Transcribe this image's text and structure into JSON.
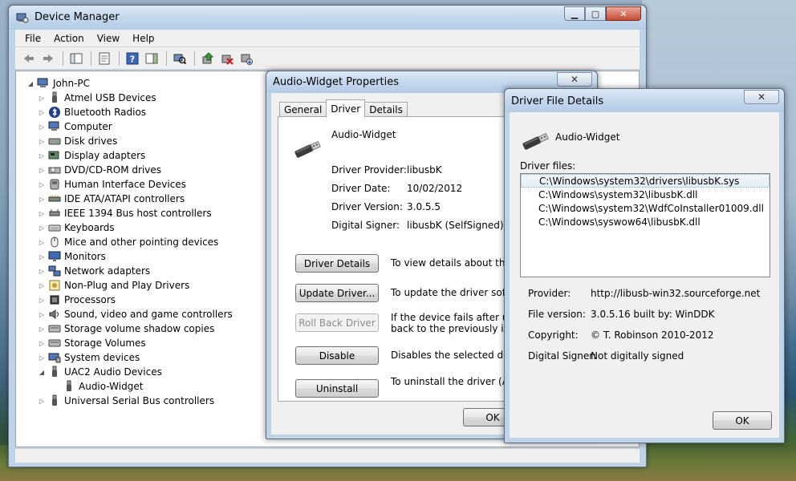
{
  "colors": {
    "selection": "#e3ecf5",
    "window_frame": "#bfd3e7",
    "close_red": "#c74a32"
  },
  "device_manager": {
    "title": "Device Manager",
    "menu": [
      "File",
      "Action",
      "View",
      "Help"
    ],
    "toolbar_icons": [
      "back-arrow-icon",
      "forward-arrow-icon",
      "console-tree-icon",
      "properties-icon",
      "help-icon",
      "action-pane-icon",
      "scan-hardware-icon",
      "update-driver-icon",
      "uninstall-icon",
      "disable-device-icon"
    ],
    "tree": {
      "root": "John-PC",
      "categories": [
        {
          "label": "Atmel USB Devices",
          "icon": "usb-plug-icon"
        },
        {
          "label": "Bluetooth Radios",
          "icon": "bluetooth-icon"
        },
        {
          "label": "Computer",
          "icon": "computer-icon"
        },
        {
          "label": "Disk drives",
          "icon": "disk-drive-icon"
        },
        {
          "label": "Display adapters",
          "icon": "display-adapter-icon"
        },
        {
          "label": "DVD/CD-ROM drives",
          "icon": "dvd-drive-icon"
        },
        {
          "label": "Human Interface Devices",
          "icon": "hid-icon"
        },
        {
          "label": "IDE ATA/ATAPI controllers",
          "icon": "ide-controller-icon"
        },
        {
          "label": "IEEE 1394 Bus host controllers",
          "icon": "firewire-icon"
        },
        {
          "label": "Keyboards",
          "icon": "keyboard-icon"
        },
        {
          "label": "Mice and other pointing devices",
          "icon": "mouse-icon"
        },
        {
          "label": "Monitors",
          "icon": "monitor-icon"
        },
        {
          "label": "Network adapters",
          "icon": "network-adapter-icon"
        },
        {
          "label": "Non-Plug and Play Drivers",
          "icon": "non-pnp-icon"
        },
        {
          "label": "Processors",
          "icon": "processor-icon"
        },
        {
          "label": "Sound, video and game controllers",
          "icon": "speaker-icon"
        },
        {
          "label": "Storage volume shadow copies",
          "icon": "storage-icon"
        },
        {
          "label": "Storage Volumes",
          "icon": "storage-icon"
        },
        {
          "label": "System devices",
          "icon": "system-device-icon"
        },
        {
          "label": "UAC2 Audio Devices",
          "icon": "usb-plug-icon",
          "expanded": true,
          "children": [
            "Audio-Widget"
          ]
        },
        {
          "label": "Universal Serial Bus controllers",
          "icon": "usb-plug-icon"
        }
      ]
    }
  },
  "properties": {
    "title": "Audio-Widget Properties",
    "tabs": [
      "General",
      "Driver",
      "Details"
    ],
    "active_tab": "Driver",
    "device_name": "Audio-Widget",
    "info": [
      {
        "label": "Driver Provider:",
        "value": "libusbK"
      },
      {
        "label": "Driver Date:",
        "value": "10/02/2012"
      },
      {
        "label": "Driver Version:",
        "value": "3.0.5.5"
      },
      {
        "label": "Digital Signer:",
        "value": "libusbK (SelfSigned)"
      }
    ],
    "buttons": {
      "driver_details": {
        "label": "Driver Details",
        "desc": "To view details about the driver files."
      },
      "update_driver": {
        "label": "Update Driver...",
        "desc": "To update the driver software for this device."
      },
      "roll_back": {
        "label": "Roll Back Driver",
        "desc_line1": "If the device fails after updating the driver, roll",
        "desc_line2": "back to the previously installed driver."
      },
      "disable": {
        "label": "Disable",
        "desc": "Disables the selected device."
      },
      "uninstall": {
        "label": "Uninstall",
        "desc": "To uninstall the driver (Advanced)."
      }
    },
    "ok": "OK"
  },
  "file_details": {
    "title": "Driver File Details",
    "device_name": "Audio-Widget",
    "files_label": "Driver files:",
    "files": [
      "C:\\Windows\\system32\\drivers\\libusbK.sys",
      "C:\\Windows\\system32\\libusbK.dll",
      "C:\\Windows\\system32\\WdfCoInstaller01009.dll",
      "C:\\Windows\\syswow64\\libusbK.dll"
    ],
    "selected_file": 0,
    "info": [
      {
        "label": "Provider:",
        "value": "http://libusb-win32.sourceforge.net"
      },
      {
        "label": "File version:",
        "value": "3.0.5.16 built by: WinDDK"
      },
      {
        "label": "Copyright:",
        "value": "© T. Robinson 2010-2012"
      },
      {
        "label": "Digital Signer:",
        "value": "Not digitally signed"
      }
    ],
    "ok": "OK"
  }
}
